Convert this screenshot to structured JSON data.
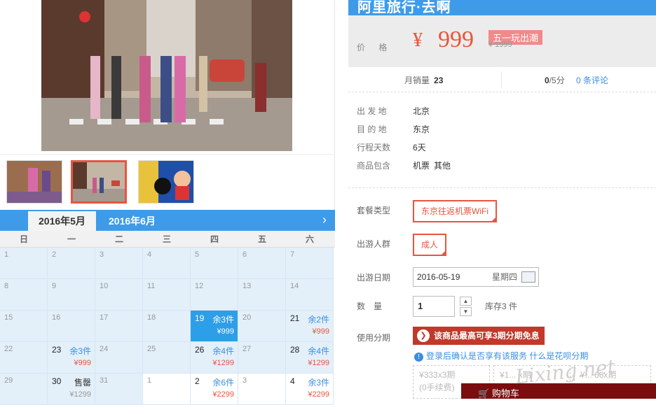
{
  "banner": {
    "title": "阿里旅行·去啊",
    "price_label": "价 格",
    "currency": "¥",
    "price": "999",
    "tag": "五一玩出潮",
    "orig_price": "¥ 1999"
  },
  "stats": {
    "sales_label": "月销量",
    "sales_value": "23",
    "score": "0",
    "score_unit": "/5分",
    "reviews": "0 条评论"
  },
  "info": {
    "rows": [
      {
        "k": "出 发 地",
        "v": "北京"
      },
      {
        "k": "目 的 地",
        "v": "东京"
      },
      {
        "k": "行程天数",
        "v": "6天"
      },
      {
        "k": "商品包含",
        "v1": "机票",
        "v2": "其他"
      }
    ]
  },
  "options": {
    "package_label": "套餐类型",
    "package_value": "东京往返机票WiFi",
    "group_label": "出游人群",
    "group_value": "成人",
    "date_label": "出游日期",
    "date_value": "2016-05-19",
    "date_weekday": "星期四",
    "qty_label": "数　量",
    "qty_value": "1",
    "stock": "库存3 件",
    "installment_label": "使用分期",
    "installment_text": "该商品最高可享3期分期免息",
    "login_note": "登录后确认是否享有该服务",
    "huabei": "什么是花呗分期",
    "plan1_line1": "¥333x3期",
    "plan1_line2": "(0手续费)",
    "plan2_line1": "¥1... x期",
    "plan3_line1": "¥... 66x期",
    "cart": "购物车"
  },
  "calendar": {
    "tab_active": "2016年5月",
    "tab_next": "2016年6月",
    "weekdays": [
      "日",
      "一",
      "二",
      "三",
      "四",
      "五",
      "六"
    ]
  },
  "calendar_cells": [
    {
      "d": "1"
    },
    {
      "d": "2"
    },
    {
      "d": "3"
    },
    {
      "d": "4"
    },
    {
      "d": "5"
    },
    {
      "d": "6"
    },
    {
      "d": "7"
    },
    {
      "d": "8"
    },
    {
      "d": "9"
    },
    {
      "d": "10"
    },
    {
      "d": "11"
    },
    {
      "d": "12"
    },
    {
      "d": "13"
    },
    {
      "d": "14"
    },
    {
      "d": "15"
    },
    {
      "d": "16"
    },
    {
      "d": "17"
    },
    {
      "d": "18"
    },
    {
      "d": "19",
      "rem": "余3件",
      "price": "¥999",
      "hl": true
    },
    {
      "d": "20"
    },
    {
      "d": "21",
      "rem": "余2件",
      "price": "¥999"
    },
    {
      "d": "22"
    },
    {
      "d": "23",
      "rem": "余3件",
      "price": "¥999"
    },
    {
      "d": "24"
    },
    {
      "d": "25"
    },
    {
      "d": "26",
      "rem": "余4件",
      "price": "¥1299"
    },
    {
      "d": "27"
    },
    {
      "d": "28",
      "rem": "余4件",
      "price": "¥1299"
    },
    {
      "d": "29"
    },
    {
      "d": "30",
      "soldout": "售罄",
      "price": "¥1299"
    },
    {
      "d": "31"
    },
    {
      "d": "1",
      "white": true
    },
    {
      "d": "2",
      "rem": "余6件",
      "price": "¥2299",
      "white": true
    },
    {
      "d": "3",
      "white": true
    },
    {
      "d": "4",
      "rem": "余3件",
      "price": "¥2299",
      "white": true
    }
  ],
  "watermark": "Lixing.net",
  "colors": {
    "accent": "#3d9be9",
    "price": "#e8553e",
    "highlight": "#2d9ee8",
    "installment": "#c0392b"
  }
}
